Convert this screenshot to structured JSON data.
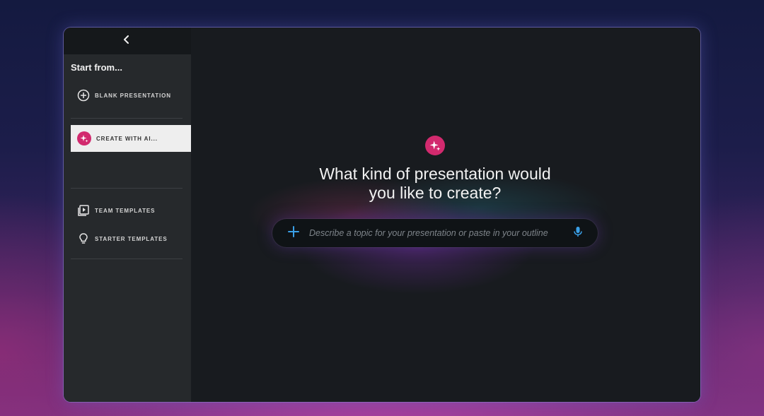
{
  "sidebar": {
    "title": "Start from...",
    "items": [
      {
        "label": "BLANK PRESENTATION",
        "icon": "plus-circle-icon"
      },
      {
        "label": "CREATE WITH AI...",
        "icon": "sparkle-icon",
        "active": true
      },
      {
        "label": "TEAM TEMPLATES",
        "icon": "play-library-icon"
      },
      {
        "label": "STARTER TEMPLATES",
        "icon": "lightbulb-icon"
      }
    ]
  },
  "main": {
    "heading_line1": "What kind of presentation would",
    "heading_line2": "you like to create?",
    "prompt": {
      "placeholder": "Describe a topic for your presentation or paste in your outline",
      "value": ""
    }
  },
  "colors": {
    "accent": "#d22a6e",
    "mic": "#3aa0e8",
    "plus": "#3aa0e8"
  }
}
